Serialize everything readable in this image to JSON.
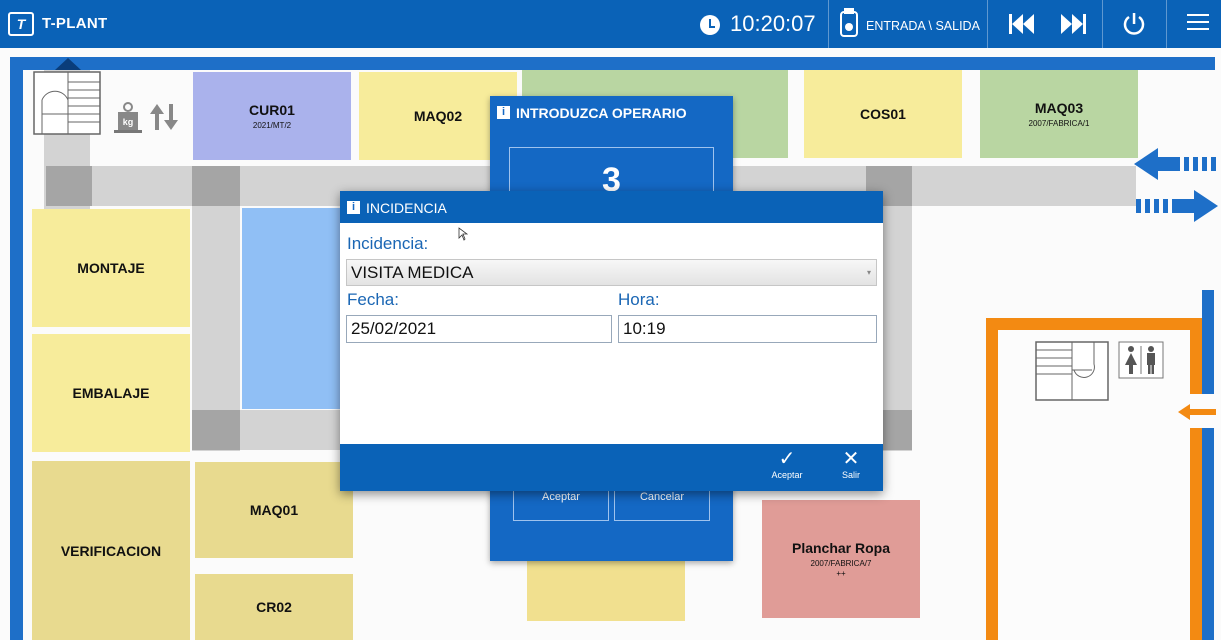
{
  "app": {
    "title": "T-PLANT",
    "logo_text": "T"
  },
  "header": {
    "clock": "10:20:07",
    "entrada_salida_label": "ENTRADA \\ SALIDA"
  },
  "floor": {
    "zones": {
      "cur01": {
        "name": "CUR01",
        "sub": "2021/MT/2"
      },
      "maq02": {
        "name": "MAQ02"
      },
      "cos01": {
        "name": "COS01"
      },
      "maq03": {
        "name": "MAQ03",
        "sub": "2007/FABRICA/1"
      },
      "montaje": {
        "name": "MONTAJE"
      },
      "embalaje": {
        "name": "EMBALAJE"
      },
      "verificacion": {
        "name": "VERIFICACION"
      },
      "maq01": {
        "name": "MAQ01"
      },
      "cr02": {
        "name": "CR02"
      },
      "planchar": {
        "name": "Planchar Ropa",
        "sub": "2007/FABRICA/7",
        "sub2": "++"
      }
    },
    "scale_icon_label": "kg"
  },
  "operator_dialog": {
    "title": "INTRODUZCA OPERARIO",
    "value": "3",
    "accept_label": "Aceptar",
    "cancel_label": "Cancelar"
  },
  "incidencia_dialog": {
    "title": "INCIDENCIA",
    "incidencia_label": "Incidencia:",
    "incidencia_value": "VISITA MEDICA",
    "fecha_label": "Fecha:",
    "fecha_value": "25/02/2021",
    "hora_label": "Hora:",
    "hora_value": "10:19",
    "accept_label": "Aceptar",
    "exit_label": "Salir"
  },
  "colors": {
    "primary_blue": "#0a62b7",
    "label_blue": "#1a66b4",
    "orange": "#f38a12"
  }
}
